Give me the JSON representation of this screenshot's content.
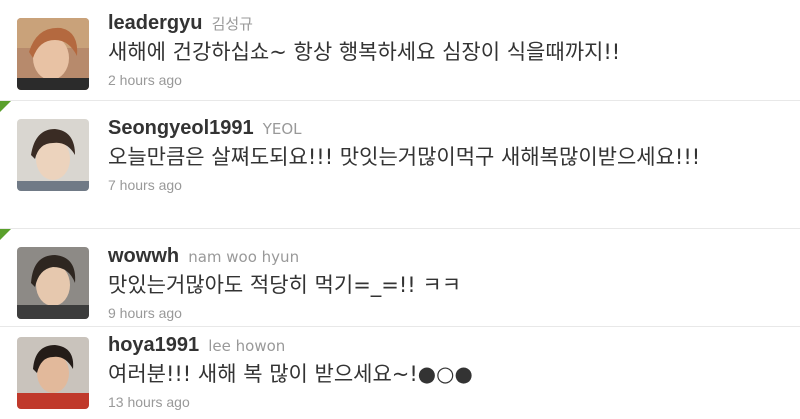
{
  "timeline": {
    "tweets": [
      {
        "username": "leadergyu",
        "full_name": "김성규",
        "text": "새해에 건강하십쇼~ 항상 행복하세요 심장이 식을때까지!!",
        "time": "2 hours ago",
        "avatar": "avatar-photo-leadergyu"
      },
      {
        "username": "Seongyeol1991",
        "full_name": "YEOL",
        "text": "오늘만큼은 살쪄도되요!!! 맛잇는거많이먹구 새해복많이받으세요!!!",
        "time": "7 hours ago",
        "avatar": "avatar-photo-seongyeol1991"
      },
      {
        "username": "wowwh",
        "full_name": "nam woo hyun",
        "text": "맛있는거많아도 적당히 먹기=_=!! ㅋㅋ",
        "time": "9 hours ago",
        "avatar": "avatar-photo-wowwh"
      },
      {
        "username": "hoya1991",
        "full_name": "lee howon",
        "text": "여러분!!! 새해 복 많이 받으세요~!●○●",
        "time": "13 hours ago",
        "avatar": "avatar-photo-hoya1991"
      }
    ],
    "colors": {
      "username": "#333333",
      "muted": "#999999",
      "corner_marker": "#5aa02c"
    }
  }
}
